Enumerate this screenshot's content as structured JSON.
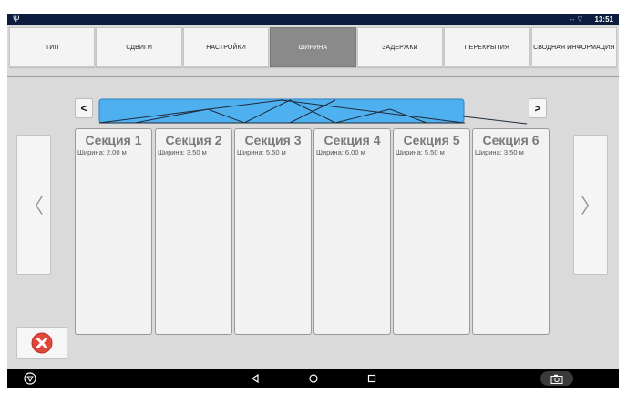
{
  "statusbar": {
    "usb_icon": "usb-icon",
    "signal_icon": "signal-icon",
    "time": "13:51"
  },
  "tabs": [
    {
      "label": "ТИП",
      "active": false
    },
    {
      "label": "СДВИГИ",
      "active": false
    },
    {
      "label": "НАСТРОЙКИ",
      "active": false
    },
    {
      "label": "ШИРИНА",
      "active": true
    },
    {
      "label": "ЗАДЕРЖКИ",
      "active": false
    },
    {
      "label": "ПЕРЕКРЫТИЯ",
      "active": false
    },
    {
      "label": "СВОДНАЯ ИНФОРМАЦИЯ",
      "active": false
    }
  ],
  "boom_nav": {
    "prev_label": "<",
    "next_label": ">"
  },
  "sections": [
    {
      "title": "Секция 1",
      "width": "Ширина: 2.00 м"
    },
    {
      "title": "Секция 2",
      "width": "Ширина: 3.50 м"
    },
    {
      "title": "Секция 3",
      "width": "Ширина: 5.50 м"
    },
    {
      "title": "Секция 4",
      "width": "Ширина: 6.00 м"
    },
    {
      "title": "Секция 5",
      "width": "Ширина: 5.50 м"
    },
    {
      "title": "Секция 6",
      "width": "Ширина: 3.50 м"
    }
  ],
  "side_nav": {
    "left_label": "〈",
    "right_label": "〉"
  },
  "cancel": {
    "icon": "close-icon",
    "color": "#e0473a"
  },
  "navbar": {
    "icons": [
      "triangle-menu-icon",
      "back-icon",
      "home-icon",
      "recents-icon",
      "camera-icon"
    ]
  },
  "colors": {
    "boom_fill": "#4fb0f0",
    "status_bar": "#0b1c3f",
    "active_tab": "#8a8a8a"
  }
}
